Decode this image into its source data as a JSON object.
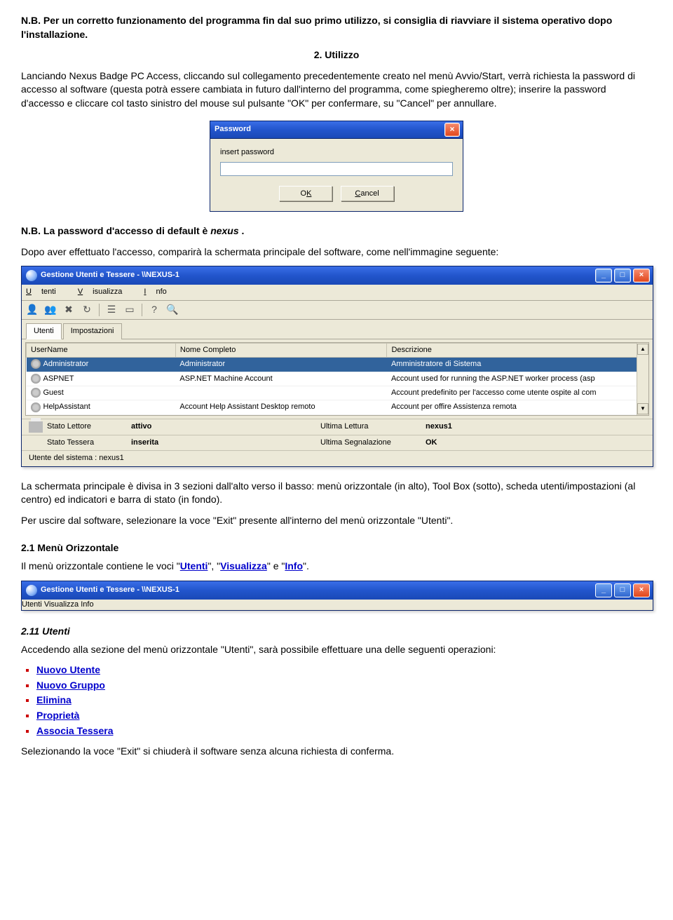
{
  "p_nb1": "N.B. Per un corretto funzionamento del programma fin dal suo primo utilizzo, si consiglia di riavviare il sistema operativo dopo l'installazione.",
  "h_utilizzo": "2. Utilizzo",
  "p_utilizzo": "Lanciando Nexus Badge PC Access, cliccando sul collegamento precedentemente creato nel menù Avvio/Start, verrà richiesta la password di accesso al software (questa potrà essere cambiata in futuro dall'interno del programma, come spiegheremo oltre); inserire la password d'accesso e cliccare col tasto sinistro del mouse sul pulsante \"OK\" per confermare, su \"Cancel\" per annullare.",
  "dlg": {
    "title": "Password",
    "label": "insert password",
    "ok_pre": "O",
    "ok_u": "K",
    "cancel_u": "C",
    "cancel_post": "ancel"
  },
  "nb_default_pre": "N.B. La password d'accesso di default è ",
  "nb_default_val": "nexus",
  "nb_default_post": " .",
  "p_after_login": "Dopo aver effettuato l'accesso, comparirà la schermata principale del software, come nell'immagine seguente:",
  "win": {
    "title": "Gestione Utenti e Tessere - \\\\NEXUS-1",
    "menu": {
      "m1_u": "U",
      "m1_r": "tenti",
      "m2_u": "V",
      "m2_r": "isualizza",
      "m3_u": "I",
      "m3_r": "nfo"
    },
    "tabs": {
      "t1": "Utenti",
      "t2": "Impostazioni"
    },
    "cols": {
      "c1": "UserName",
      "c2": "Nome Completo",
      "c3": "Descrizione"
    },
    "rows": [
      {
        "u": "Administrator",
        "n": "Administrator",
        "d": "Amministratore di Sistema",
        "sel": true
      },
      {
        "u": "ASPNET",
        "n": "ASP.NET Machine Account",
        "d": "Account used for running the ASP.NET worker process (asp"
      },
      {
        "u": "Guest",
        "n": "",
        "d": "Account predefinito per l'accesso come utente ospite al com"
      },
      {
        "u": "HelpAssistant",
        "n": "Account Help Assistant Desktop remoto",
        "d": "Account per offire Assistenza remota"
      }
    ],
    "s1": {
      "lab": "Stato Lettore",
      "val": "attivo",
      "lab2": "Ultima Lettura",
      "val2": "nexus1"
    },
    "s2": {
      "lab": "Stato Tessera",
      "val": "inserita",
      "lab2": "Ultima Segnalazione",
      "val2": "OK"
    },
    "s3": "Utente del sistema : nexus1"
  },
  "p_sections": "La schermata principale è divisa in 3 sezioni dall'alto verso il basso: menù orizzontale (in alto), Tool Box (sotto), scheda utenti/impostazioni (al centro) ed indicatori e barra di stato (in fondo).",
  "p_exit": "Per uscire dal software, selezionare la voce \"Exit\" presente all'interno del menù orizzontale \"Utenti\".",
  "h_menu": "2.1  Menù Orizzontale",
  "p_menu_pre": "Il menù orizzontale contiene le voci \"",
  "p_menu_l1": "Utenti",
  "p_menu_mid1": "\", \"",
  "p_menu_l2": "Visualizza",
  "p_menu_mid2": "\" e \"",
  "p_menu_l3": "Info",
  "p_menu_post": "\".",
  "h_utenti": "2.11  Utenti",
  "p_utenti": "Accedendo alla sezione del menù orizzontale \"Utenti\", sarà possibile effettuare una delle seguenti operazioni:",
  "links": [
    "Nuovo Utente",
    "Nuovo Gruppo",
    "Elimina",
    "Proprietà",
    "Associa Tessera"
  ],
  "p_last": "Selezionando la voce \"Exit\" si chiuderà il software senza alcuna richiesta di conferma."
}
